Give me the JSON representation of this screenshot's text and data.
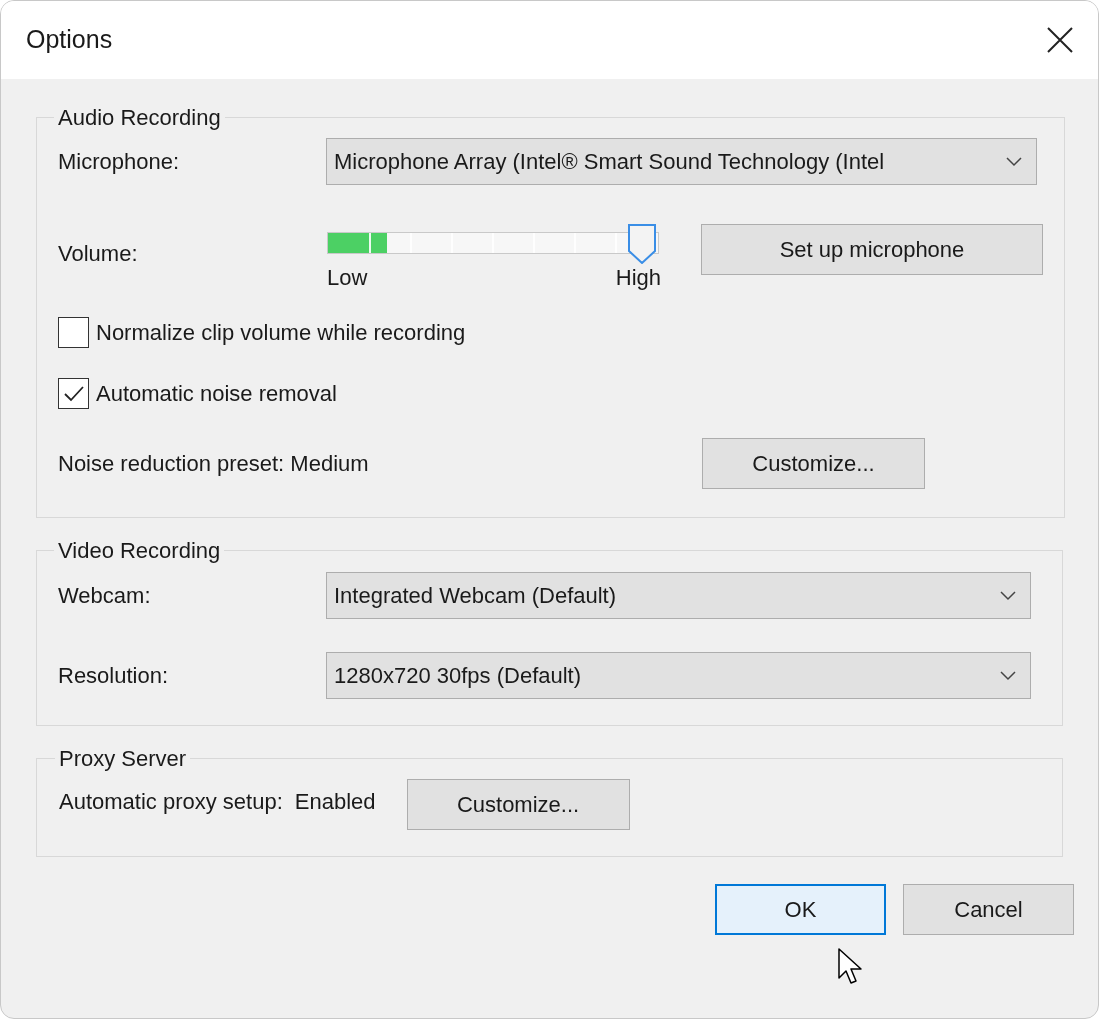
{
  "window": {
    "title": "Options"
  },
  "audio_recording": {
    "title": "Audio Recording",
    "microphone": {
      "label": "Microphone:",
      "value": "Microphone Array (Intel® Smart Sound Technology (Intel"
    },
    "volume": {
      "label": "Volume:",
      "level": 0.95,
      "input_meter": {
        "level": 0.18
      },
      "min_label": "Low",
      "max_label": "High"
    },
    "setup_button": "Set up microphone",
    "options": [
      {
        "label": "Normalize clip volume while recording",
        "checked": false
      },
      {
        "label": "Automatic noise removal",
        "checked": true
      }
    ],
    "noise_preset": {
      "label": "Noise reduction preset: Medium",
      "button": "Customize..."
    }
  },
  "video_recording": {
    "title": "Video Recording",
    "fields": [
      {
        "label": "Webcam:",
        "value": "Integrated Webcam (Default)"
      },
      {
        "label": "Resolution:",
        "value": "1280x720 30fps (Default)"
      }
    ]
  },
  "proxy_server": {
    "title": "Proxy Server",
    "label": "Automatic proxy setup:",
    "value": "Enabled",
    "button": "Customize..."
  },
  "buttons": [
    {
      "label": "OK",
      "default": true
    },
    {
      "label": "Cancel",
      "default": false
    }
  ]
}
